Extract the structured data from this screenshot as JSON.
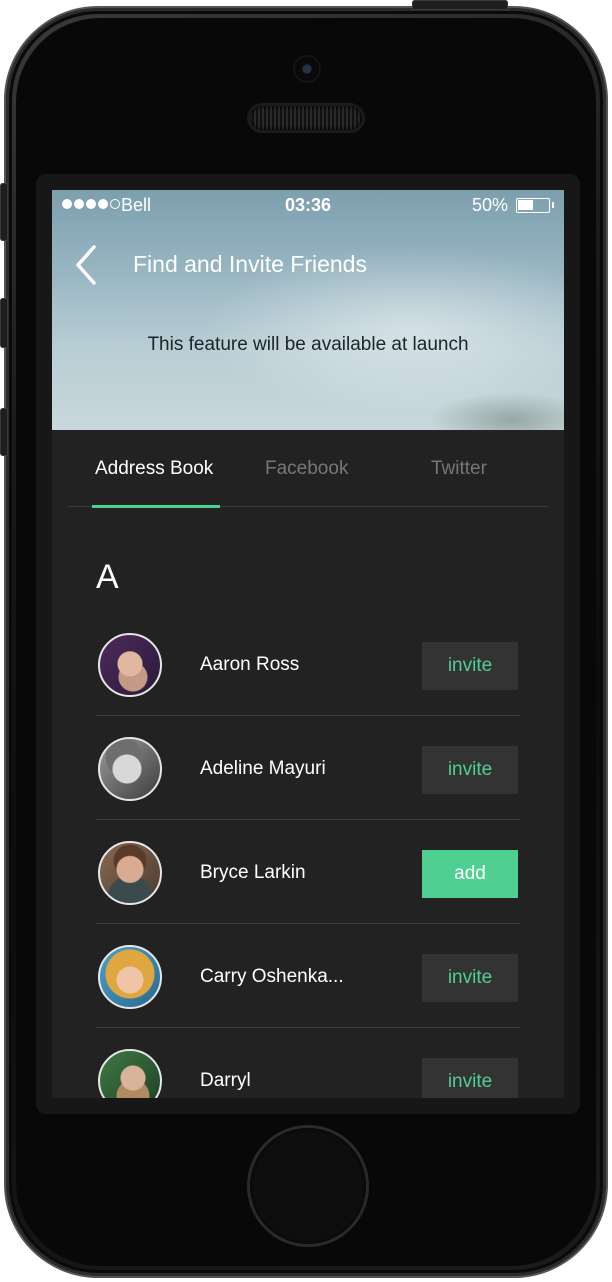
{
  "status_bar": {
    "carrier": "Bell",
    "time": "03:36",
    "battery": "50%",
    "battery_level": 0.5
  },
  "header": {
    "back_icon": "chevron-left-icon",
    "title": "Find and Invite Friends",
    "notice": "This feature will be available at launch"
  },
  "tabs": [
    {
      "label": "Address Book",
      "active": true
    },
    {
      "label": "Facebook",
      "active": false
    },
    {
      "label": "Twitter",
      "active": false
    }
  ],
  "section": {
    "letter": "A"
  },
  "contacts": [
    {
      "name": "Aaron Ross",
      "action": "invite"
    },
    {
      "name": "Adeline Mayuri",
      "action": "invite"
    },
    {
      "name": "Bryce Larkin",
      "action": "add"
    },
    {
      "name": "Carry Oshenka...",
      "action": "invite"
    },
    {
      "name": "Darryl",
      "action": "invite"
    }
  ],
  "colors": {
    "accent": "#4fcf92",
    "background": "#222222",
    "button_bg": "#333333"
  }
}
